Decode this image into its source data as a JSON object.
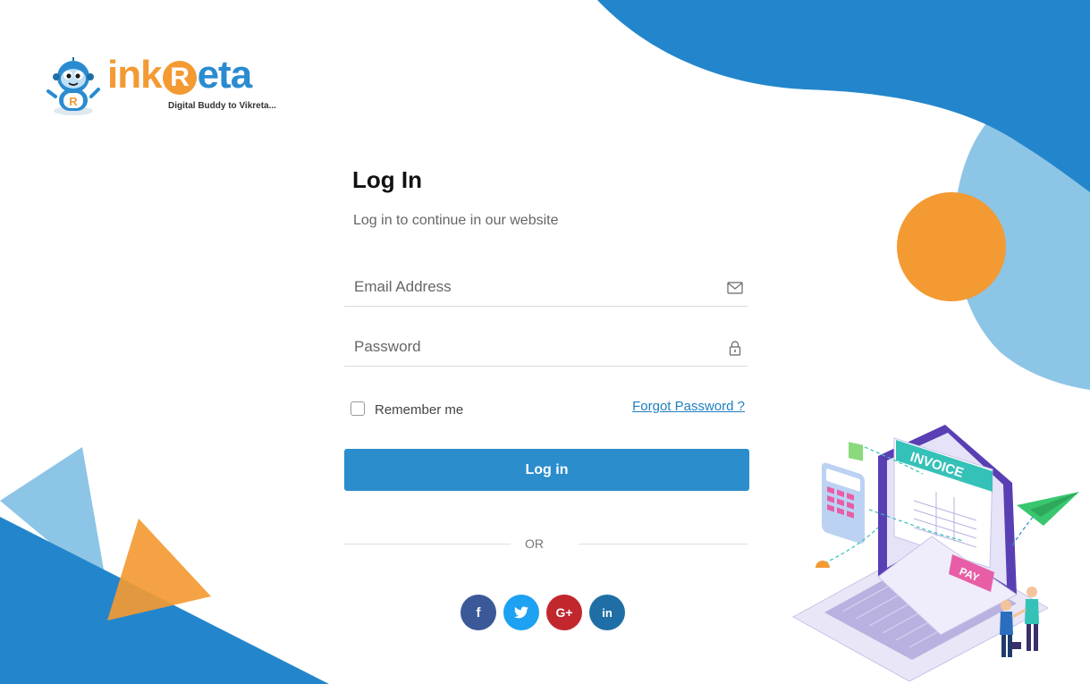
{
  "logo": {
    "part_ink": "ink",
    "part_r": "R",
    "part_eta": "eta",
    "tagline": "Digital Buddy to Vikreta..."
  },
  "login": {
    "title": "Log In",
    "subtitle": "Log in to continue in our website"
  },
  "fields": {
    "email_placeholder": "Email Address",
    "password_placeholder": "Password"
  },
  "remember_label": "Remember me",
  "forgot_label": "Forgot Password ?",
  "submit_label": "Log in",
  "divider_label": "OR",
  "socials": [
    {
      "name": "facebook",
      "glyph": "f"
    },
    {
      "name": "twitter",
      "glyph": "t"
    },
    {
      "name": "google-plus",
      "glyph": "G+"
    },
    {
      "name": "linkedin",
      "glyph": "in"
    }
  ],
  "illustration": {
    "invoice_label": "INVOICE",
    "pay_label": "PAY"
  },
  "colors": {
    "primary_blue": "#2b8dcc",
    "light_blue": "#8cc5e6",
    "orange": "#f39a33"
  }
}
